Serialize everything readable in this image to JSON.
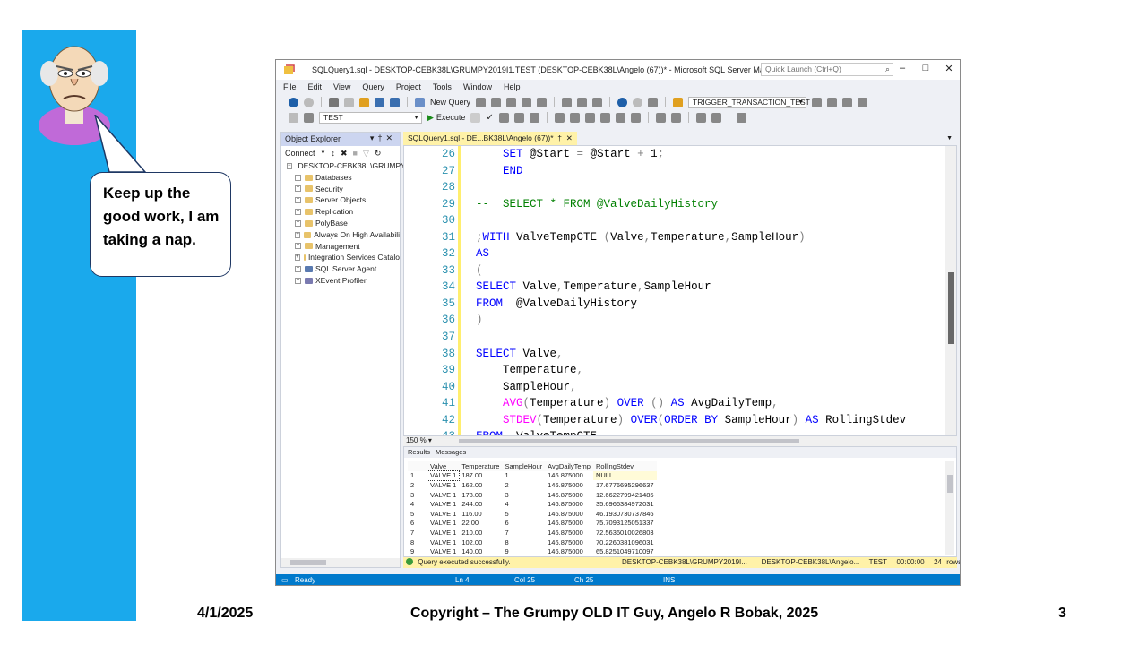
{
  "speech_bubble": "Keep up the good work, I am taking a nap.",
  "ssms": {
    "title": "SQLQuery1.sql - DESKTOP-CEBK38L\\GRUMPY2019I1.TEST (DESKTOP-CEBK38L\\Angelo (67))* - Microsoft SQL Server Management S...",
    "quick_launch_placeholder": "Quick Launch (Ctrl+Q)",
    "menu": [
      "File",
      "Edit",
      "View",
      "Query",
      "Project",
      "Tools",
      "Window",
      "Help"
    ],
    "new_query_label": "New Query",
    "trigger_dropdown": "TRIGGER_TRANSACTION_TEST",
    "database_dropdown": "TEST",
    "execute_label": "Execute",
    "object_explorer": {
      "title": "Object Explorer",
      "connect_label": "Connect",
      "root": "DESKTOP-CEBK38L\\GRUMPY",
      "items": [
        "Databases",
        "Security",
        "Server Objects",
        "Replication",
        "PolyBase",
        "Always On High Availabili",
        "Management",
        "Integration Services Catalo",
        "SQL Server Agent",
        "XEvent Profiler"
      ]
    },
    "editor_tab": "SQLQuery1.sql - DE...BK38L\\Angelo (67))*",
    "zoom": "150 %",
    "code_lines": [
      {
        "n": "26",
        "segs": [
          [
            "    ",
            "txt"
          ],
          [
            "SET",
            "kw"
          ],
          [
            " @Start ",
            "txt"
          ],
          [
            "=",
            "gy"
          ],
          [
            " @Start ",
            "txt"
          ],
          [
            "+",
            "gy"
          ],
          [
            " 1",
            "txt"
          ],
          [
            ";",
            "gy"
          ]
        ]
      },
      {
        "n": "27",
        "segs": [
          [
            "    ",
            "txt"
          ],
          [
            "END",
            "kw"
          ]
        ]
      },
      {
        "n": "28",
        "segs": []
      },
      {
        "n": "29",
        "segs": [
          [
            "--  SELECT * FROM @ValveDailyHistory",
            "cm"
          ]
        ]
      },
      {
        "n": "30",
        "segs": []
      },
      {
        "n": "31",
        "segs": [
          [
            ";",
            "gy"
          ],
          [
            "WITH",
            "kw"
          ],
          [
            " ValveTempCTE ",
            "txt"
          ],
          [
            "(",
            "gy"
          ],
          [
            "Valve",
            "txt"
          ],
          [
            ",",
            "gy"
          ],
          [
            "Temperature",
            "txt"
          ],
          [
            ",",
            "gy"
          ],
          [
            "SampleHour",
            "txt"
          ],
          [
            ")",
            "gy"
          ]
        ]
      },
      {
        "n": "32",
        "segs": [
          [
            "AS",
            "kw"
          ]
        ]
      },
      {
        "n": "33",
        "segs": [
          [
            "(",
            "gy"
          ]
        ]
      },
      {
        "n": "34",
        "segs": [
          [
            "SELECT",
            "kw"
          ],
          [
            " Valve",
            "txt"
          ],
          [
            ",",
            "gy"
          ],
          [
            "Temperature",
            "txt"
          ],
          [
            ",",
            "gy"
          ],
          [
            "SampleHour",
            "txt"
          ]
        ]
      },
      {
        "n": "35",
        "segs": [
          [
            "FROM",
            "kw"
          ],
          [
            "  @ValveDailyHistory",
            "txt"
          ]
        ]
      },
      {
        "n": "36",
        "segs": [
          [
            ")",
            "gy"
          ]
        ]
      },
      {
        "n": "37",
        "segs": []
      },
      {
        "n": "38",
        "segs": [
          [
            "SELECT",
            "kw"
          ],
          [
            " Valve",
            "txt"
          ],
          [
            ",",
            "gy"
          ]
        ]
      },
      {
        "n": "39",
        "segs": [
          [
            "    Temperature",
            "txt"
          ],
          [
            ",",
            "gy"
          ]
        ]
      },
      {
        "n": "40",
        "segs": [
          [
            "    SampleHour",
            "txt"
          ],
          [
            ",",
            "gy"
          ]
        ]
      },
      {
        "n": "41",
        "segs": [
          [
            "    ",
            "txt"
          ],
          [
            "AVG",
            "fn"
          ],
          [
            "(",
            "gy"
          ],
          [
            "Temperature",
            "txt"
          ],
          [
            ")",
            "gy"
          ],
          [
            " OVER ",
            "kw"
          ],
          [
            "()",
            "gy"
          ],
          [
            " AS",
            "kw"
          ],
          [
            " AvgDailyTemp",
            "txt"
          ],
          [
            ",",
            "gy"
          ]
        ]
      },
      {
        "n": "42",
        "segs": [
          [
            "    ",
            "txt"
          ],
          [
            "STDEV",
            "fn"
          ],
          [
            "(",
            "gy"
          ],
          [
            "Temperature",
            "txt"
          ],
          [
            ")",
            "gy"
          ],
          [
            " OVER",
            "kw"
          ],
          [
            "(",
            "gy"
          ],
          [
            "ORDER BY",
            "kw"
          ],
          [
            " SampleHour",
            "txt"
          ],
          [
            ")",
            "gy"
          ],
          [
            " AS",
            "kw"
          ],
          [
            " RollingStdev",
            "txt"
          ]
        ]
      },
      {
        "n": "43",
        "segs": [
          [
            "FROM",
            "kw"
          ],
          [
            "  ValveTempCTE",
            "txt"
          ]
        ]
      }
    ],
    "results_tabs": [
      "Results",
      "Messages"
    ],
    "result_columns": [
      "Valve",
      "Temperature",
      "SampleHour",
      "AvgDailyTemp",
      "RollingStdev"
    ],
    "result_rows": [
      [
        "1",
        "VALVE 1",
        "187.00",
        "1",
        "146.875000",
        "NULL"
      ],
      [
        "2",
        "VALVE 1",
        "162.00",
        "2",
        "146.875000",
        "17.6776695296637"
      ],
      [
        "3",
        "VALVE 1",
        "178.00",
        "3",
        "146.875000",
        "12.6622799421485"
      ],
      [
        "4",
        "VALVE 1",
        "244.00",
        "4",
        "146.875000",
        "35.6966384972031"
      ],
      [
        "5",
        "VALVE 1",
        "116.00",
        "5",
        "146.875000",
        "46.1930730737846"
      ],
      [
        "6",
        "VALVE 1",
        "22.00",
        "6",
        "146.875000",
        "75.7093125051337"
      ],
      [
        "7",
        "VALVE 1",
        "210.00",
        "7",
        "146.875000",
        "72.5636010026803"
      ],
      [
        "8",
        "VALVE 1",
        "102.00",
        "8",
        "146.875000",
        "70.2260381096031"
      ],
      [
        "9",
        "VALVE 1",
        "140.00",
        "9",
        "146.875000",
        "65.8251049710097"
      ]
    ],
    "query_status": "Query executed successfully.",
    "query_server": "DESKTOP-CEBK38L\\GRUMPY2019I...",
    "query_user": "DESKTOP-CEBK38L\\Angelo...",
    "query_db": "TEST",
    "query_time": "00:00:00",
    "query_rows": "24 rows",
    "status": {
      "ready": "Ready",
      "ln": "Ln 4",
      "col": "Col 25",
      "ch": "Ch 25",
      "ins": "INS"
    }
  },
  "footer": {
    "date": "4/1/2025",
    "copyright": "Copyright – The Grumpy OLD IT Guy, Angelo R Bobak, 2025",
    "page": "3"
  }
}
